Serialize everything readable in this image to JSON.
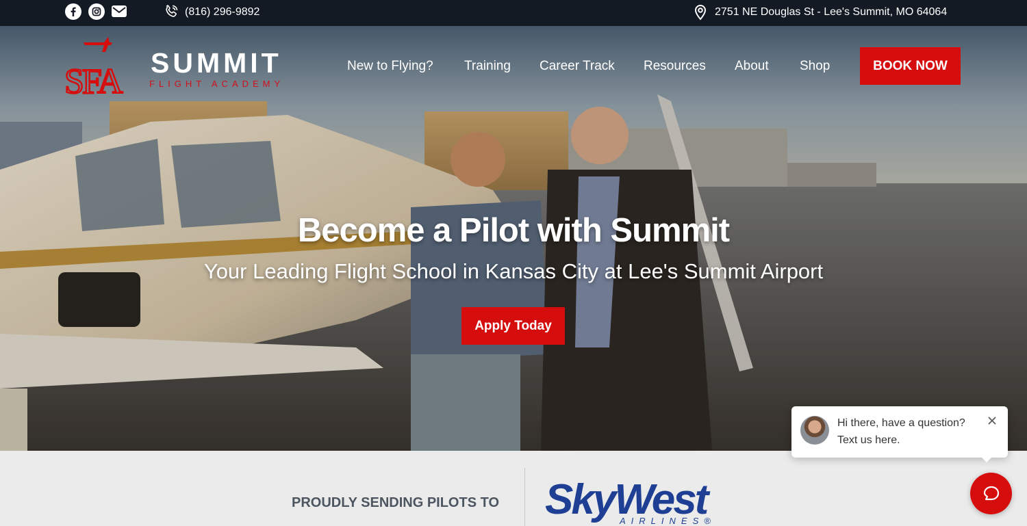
{
  "topbar": {
    "phone": "(816) 296-9892",
    "address": "2751 NE Douglas St - Lee's Summit, MO 64064",
    "social_icons": [
      "facebook-icon",
      "instagram-icon",
      "mail-icon"
    ]
  },
  "brand": {
    "monogram": "SFA",
    "name": "SUMMIT",
    "tagline": "FLIGHT ACADEMY"
  },
  "nav": {
    "items": [
      "New to Flying?",
      "Training",
      "Career Track",
      "Resources",
      "About",
      "Shop"
    ],
    "cta": "BOOK NOW"
  },
  "hero": {
    "title": "Become a Pilot with Summit",
    "subtitle": "Your Leading Flight School in Kansas City at Lee's Summit Airport",
    "cta": "Apply Today"
  },
  "partners": {
    "label": "PROUDLY SENDING PILOTS TO",
    "logo_name": "SkyWest",
    "logo_sub": "AIRLINES",
    "logo_mark": "®"
  },
  "chat": {
    "line1": "Hi there, have a question?",
    "line2": "Text us here."
  },
  "colors": {
    "accent": "#d60d0d",
    "topbar": "#141a24",
    "skywest_blue": "#1e3f93"
  }
}
